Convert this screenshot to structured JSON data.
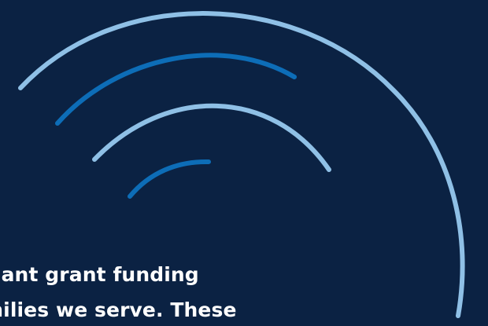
{
  "page": {
    "background_color": "#0b2243",
    "text_color": "#ffffff",
    "arc_light_color": "#8fc0e6",
    "arc_dark_color": "#0d6db7"
  },
  "content": {
    "lines": [
      "icant grant funding",
      "milies we serve. These"
    ]
  }
}
